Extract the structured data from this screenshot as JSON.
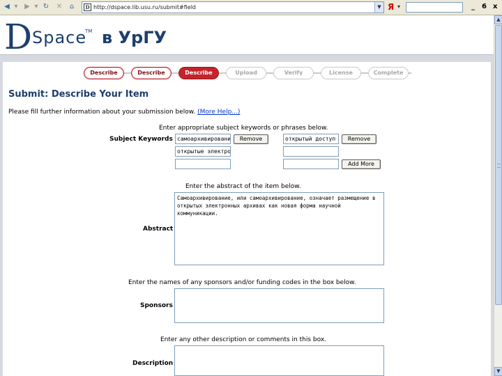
{
  "browser": {
    "back_icon": "back-arrow-icon",
    "forward_icon": "forward-arrow-icon",
    "url": "http://dspace.lib.usu.ru/submit#field",
    "favicon_letter": "D",
    "yandex_label": "Я",
    "window_controls": {
      "minimize": "_",
      "restore": "6",
      "close": "x"
    }
  },
  "header": {
    "logo_d": "D",
    "logo_space": "Space",
    "logo_tm": "TM",
    "logo_suffix": "в УрГУ"
  },
  "steps": [
    {
      "label": "Describe",
      "state": "done"
    },
    {
      "label": "Describe",
      "state": "done"
    },
    {
      "label": "Describe",
      "state": "current"
    },
    {
      "label": "Upload",
      "state": "todo"
    },
    {
      "label": "Verify",
      "state": "todo"
    },
    {
      "label": "License",
      "state": "todo"
    },
    {
      "label": "Complete",
      "state": "todo"
    }
  ],
  "form": {
    "title": "Submit: Describe Your Item",
    "intro_text": "Please fill further information about your submission below.",
    "intro_link": "(More Help...)",
    "keywords": {
      "hint": "Enter appropriate subject keywords or phrases below.",
      "label": "Subject Keywords",
      "values": [
        "самоархивирование",
        "открытый доступ",
        "открытые электронные архивы",
        "",
        ""
      ],
      "remove_label": "Remove",
      "add_more_label": "Add More"
    },
    "abstract": {
      "hint": "Enter the abstract of the item below.",
      "label": "Abstract",
      "value": "Самоархивирование, или самоархивирование, означает размещение в открытых электронных архивах как новая форма научной коммуникации."
    },
    "sponsors": {
      "hint": "Enter the names of any sponsors and/or funding codes in the box below.",
      "label": "Sponsors",
      "value": ""
    },
    "description": {
      "hint": "Enter any other description or comments in this box.",
      "label": "Description",
      "value": ""
    }
  }
}
